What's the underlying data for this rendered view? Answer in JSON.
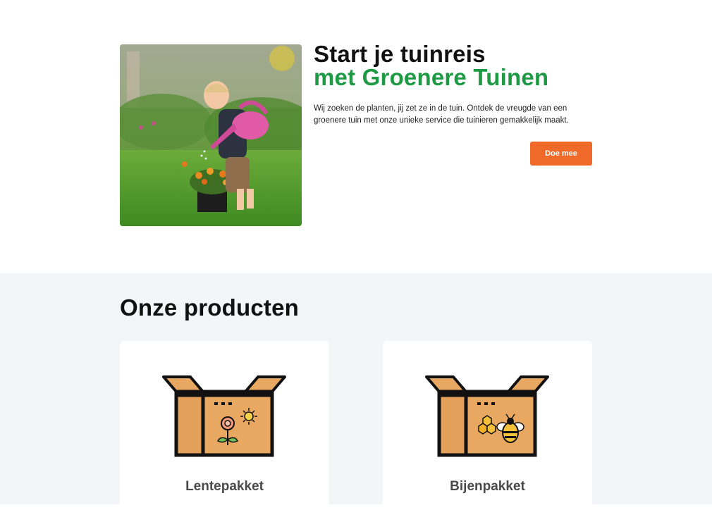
{
  "hero": {
    "image_alt": "Kind met gieter in de tuin",
    "title_line1": "Start je tuinreis",
    "title_line2": "met Groenere Tuinen",
    "description": "Wij zoeken de planten, jij zet ze in de tuin. Ontdek de vreugde van een groenere tuin met onze unieke service die tuinieren gemakkelijk maakt.",
    "cta_label": "Doe mee"
  },
  "products": {
    "title": "Onze producten",
    "items": [
      {
        "name": "Lentepakket",
        "icon": "box-flower-sun-icon"
      },
      {
        "name": "Bijenpakket",
        "icon": "box-honeycomb-bee-icon"
      }
    ]
  },
  "colors": {
    "accent_green": "#1e9a44",
    "cta_orange": "#ef6a28",
    "box_tan": "#e8a862",
    "section_bg": "#f3f5f9"
  }
}
